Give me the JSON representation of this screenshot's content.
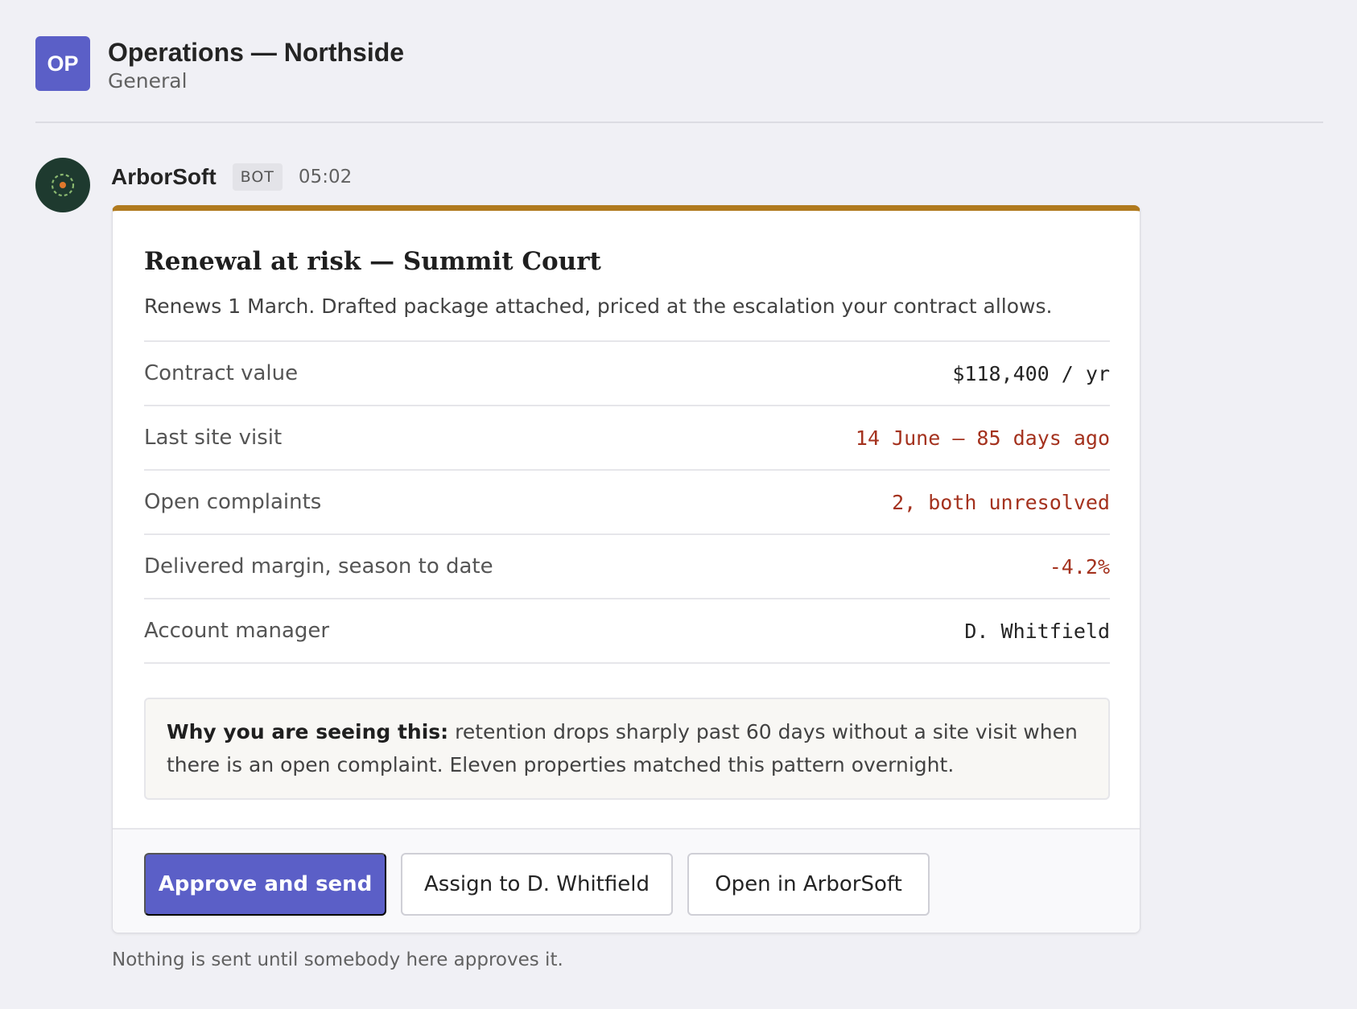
{
  "header": {
    "team_initials": "OP",
    "team_name": "Operations — Northside",
    "channel": "General"
  },
  "message": {
    "sender": "ArborSoft",
    "badge": "BOT",
    "time": "05:02",
    "footnote": "Nothing is sent until somebody here approves it."
  },
  "card": {
    "accent_color": "#b07a1e",
    "title": "Renewal at risk — Summit Court",
    "subtitle": "Renews 1 March. Drafted package attached, priced at the escalation your contract allows.",
    "facts": [
      {
        "label": "Contract value",
        "value": "$118,400 / yr",
        "alert": false
      },
      {
        "label": "Last site visit",
        "value": "14 June — 85 days ago",
        "alert": true
      },
      {
        "label": "Open complaints",
        "value": "2, both unresolved",
        "alert": true
      },
      {
        "label": "Delivered margin, season to date",
        "value": "-4.2%",
        "alert": true
      },
      {
        "label": "Account manager",
        "value": "D. Whitfield",
        "alert": false
      }
    ],
    "note": {
      "lead": "Why you are seeing this:",
      "text": "retention drops sharply past 60 days without a site visit when there is an open complaint. Eleven properties matched this pattern overnight."
    },
    "actions": {
      "approve": "Approve and send",
      "assign": "Assign to D. Whitfield",
      "open": "Open in ArborSoft"
    }
  },
  "colors": {
    "brand": "#5b5fc7",
    "alert": "#a4321e",
    "bot_avatar": "#1e3a2f"
  }
}
